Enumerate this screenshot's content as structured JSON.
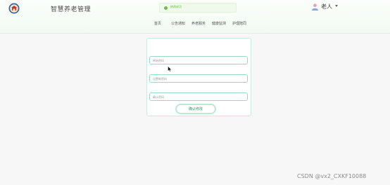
{
  "header": {
    "app_title": "智慧养老管理",
    "logo_icon": "temple-logo-icon",
    "toast_text": "修改成功",
    "toast_color": "#67c23a",
    "user": {
      "name": "老人",
      "avatar_icon": "user-avatar-icon",
      "dropdown_icon": "caret-down-icon"
    }
  },
  "nav": {
    "items": [
      {
        "label": "首页"
      },
      {
        "label": "公告通知"
      },
      {
        "label": "养老服务"
      },
      {
        "label": "健康监测"
      },
      {
        "label": "护理陪同"
      }
    ]
  },
  "form": {
    "old_password_placeholder": "原始密码",
    "new_password_placeholder": "设置新密码",
    "confirm_password_placeholder": "确认密码",
    "submit_label": "确认修改",
    "accent_color": "#9fd6bf"
  },
  "watermark": "CSDN @vx2_CXKF10088"
}
